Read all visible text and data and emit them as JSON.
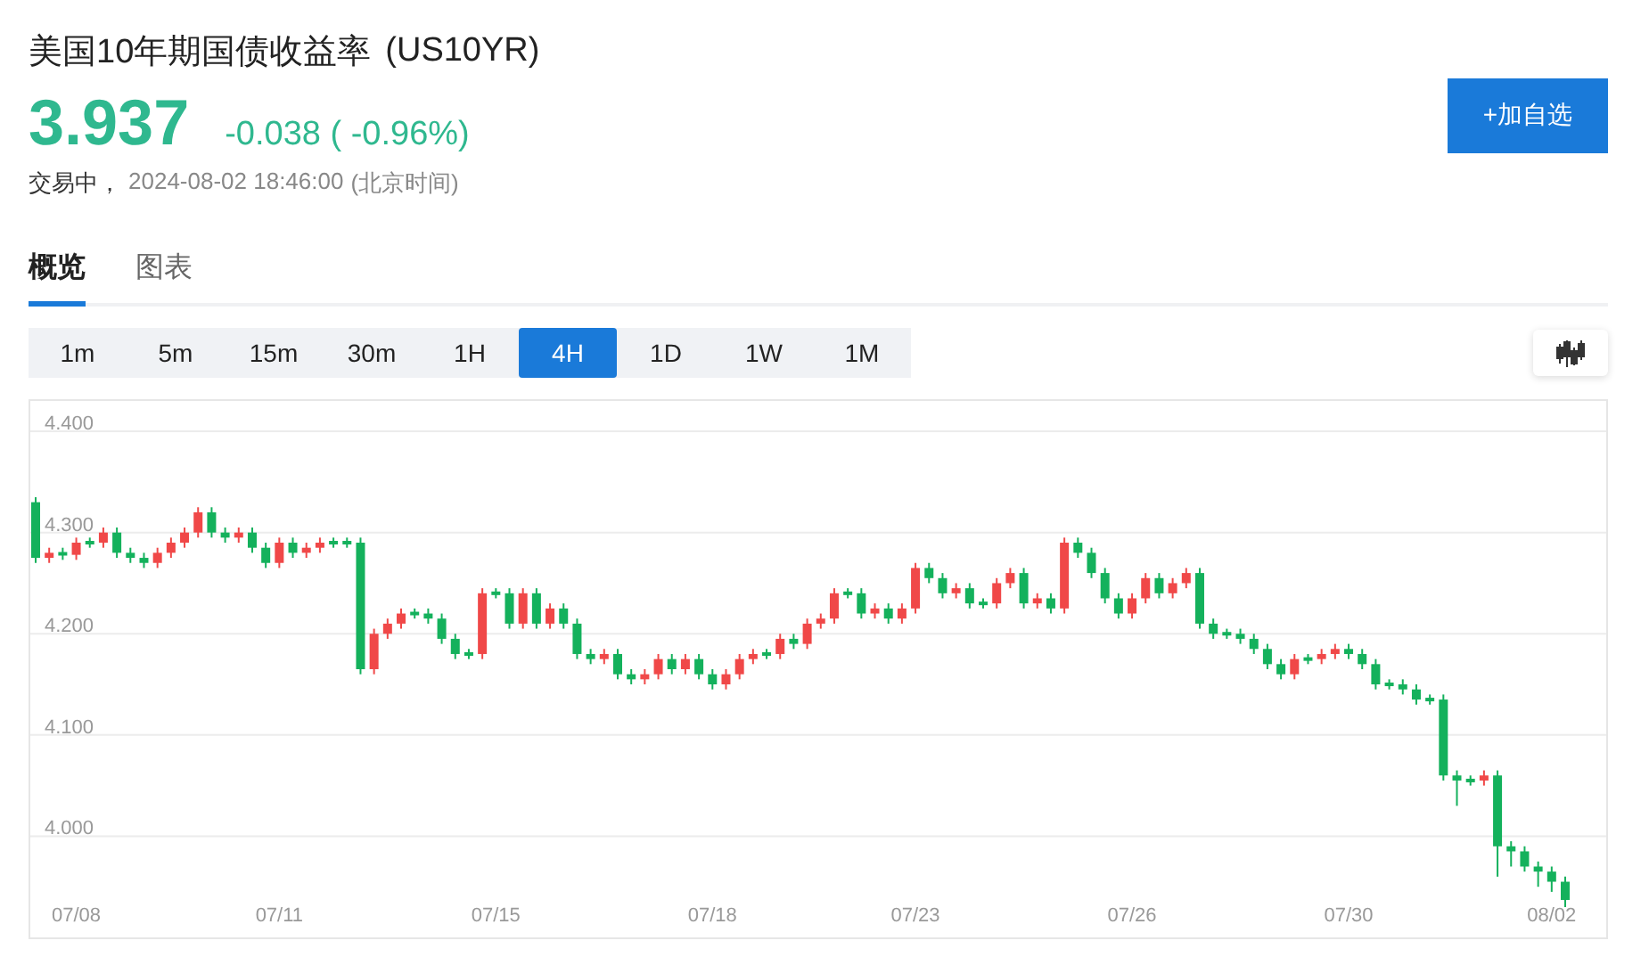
{
  "header": {
    "title": "美国10年期国债收益率",
    "symbol": "(US10YR)",
    "price": "3.937",
    "change": "-0.038 ( -0.96%)",
    "status": "交易中，",
    "timestamp": "2024-08-02 18:46:00",
    "timezone": "(北京时间)",
    "watch_button": "+加自选"
  },
  "tabs": [
    {
      "label": "概览",
      "selected": true
    },
    {
      "label": "图表",
      "selected": false
    }
  ],
  "intervals": [
    {
      "label": "1m",
      "selected": false
    },
    {
      "label": "5m",
      "selected": false
    },
    {
      "label": "15m",
      "selected": false
    },
    {
      "label": "30m",
      "selected": false
    },
    {
      "label": "1H",
      "selected": false
    },
    {
      "label": "4H",
      "selected": true
    },
    {
      "label": "1D",
      "selected": false
    },
    {
      "label": "1W",
      "selected": false
    },
    {
      "label": "1M",
      "selected": false
    }
  ],
  "chart": {
    "chart_data": {
      "type": "candlestick",
      "yticks": [
        {
          "value": 4.4,
          "label": "4.400"
        },
        {
          "value": 4.3,
          "label": "4.300"
        },
        {
          "value": 4.2,
          "label": "4.200"
        },
        {
          "value": 4.1,
          "label": "4.100"
        },
        {
          "value": 4.0,
          "label": "4.000"
        }
      ],
      "ylim": [
        3.9,
        4.43
      ],
      "grid": true,
      "categories": [
        null,
        null,
        null,
        "07/08",
        null,
        null,
        null,
        null,
        null,
        null,
        null,
        null,
        null,
        null,
        null,
        null,
        null,
        null,
        "07/11",
        null,
        null,
        null,
        null,
        null,
        null,
        null,
        null,
        null,
        null,
        null,
        null,
        null,
        null,
        null,
        "07/15",
        null,
        null,
        null,
        null,
        null,
        null,
        null,
        null,
        null,
        null,
        null,
        null,
        null,
        null,
        null,
        "07/18",
        null,
        null,
        null,
        null,
        null,
        null,
        null,
        null,
        null,
        null,
        null,
        null,
        null,
        null,
        "07/23",
        null,
        null,
        null,
        null,
        null,
        null,
        null,
        null,
        null,
        null,
        null,
        null,
        null,
        null,
        null,
        "07/26",
        null,
        null,
        null,
        null,
        null,
        null,
        null,
        null,
        null,
        null,
        null,
        null,
        null,
        null,
        null,
        "07/30",
        null,
        null,
        null,
        null,
        null,
        null,
        null,
        null,
        null,
        null,
        null,
        null,
        null,
        null,
        "08/02",
        null
      ],
      "ohlc": [
        [
          4.33,
          4.335,
          4.27,
          4.275
        ],
        [
          4.275,
          4.285,
          4.27,
          4.28
        ],
        [
          4.28,
          4.285,
          4.273,
          4.278
        ],
        [
          4.278,
          4.295,
          4.273,
          4.29
        ],
        [
          4.29,
          4.295,
          4.285,
          4.29
        ],
        [
          4.29,
          4.305,
          4.285,
          4.3
        ],
        [
          4.3,
          4.305,
          4.275,
          4.28
        ],
        [
          4.28,
          4.285,
          4.27,
          4.275
        ],
        [
          4.275,
          4.28,
          4.265,
          4.27
        ],
        [
          4.27,
          4.285,
          4.265,
          4.28
        ],
        [
          4.28,
          4.295,
          4.275,
          4.29
        ],
        [
          4.29,
          4.305,
          4.285,
          4.3
        ],
        [
          4.3,
          4.325,
          4.295,
          4.32
        ],
        [
          4.32,
          4.325,
          4.295,
          4.3
        ],
        [
          4.3,
          4.305,
          4.29,
          4.295
        ],
        [
          4.295,
          4.305,
          4.29,
          4.3
        ],
        [
          4.3,
          4.305,
          4.28,
          4.285
        ],
        [
          4.285,
          4.29,
          4.265,
          4.27
        ],
        [
          4.27,
          4.295,
          4.265,
          4.29
        ],
        [
          4.29,
          4.295,
          4.275,
          4.28
        ],
        [
          4.28,
          4.29,
          4.275,
          4.285
        ],
        [
          4.285,
          4.295,
          4.28,
          4.29
        ],
        [
          4.29,
          4.295,
          4.285,
          4.29
        ],
        [
          4.29,
          4.295,
          4.285,
          4.29
        ],
        [
          4.29,
          4.295,
          4.16,
          4.165
        ],
        [
          4.165,
          4.205,
          4.16,
          4.2
        ],
        [
          4.2,
          4.215,
          4.195,
          4.21
        ],
        [
          4.21,
          4.225,
          4.205,
          4.22
        ],
        [
          4.22,
          4.225,
          4.215,
          4.22
        ],
        [
          4.22,
          4.225,
          4.21,
          4.215
        ],
        [
          4.215,
          4.22,
          4.19,
          4.195
        ],
        [
          4.195,
          4.2,
          4.175,
          4.18
        ],
        [
          4.18,
          4.185,
          4.175,
          4.18
        ],
        [
          4.18,
          4.245,
          4.175,
          4.24
        ],
        [
          4.24,
          4.245,
          4.235,
          4.24
        ],
        [
          4.24,
          4.245,
          4.205,
          4.21
        ],
        [
          4.21,
          4.245,
          4.205,
          4.24
        ],
        [
          4.24,
          4.245,
          4.205,
          4.21
        ],
        [
          4.21,
          4.23,
          4.205,
          4.225
        ],
        [
          4.225,
          4.23,
          4.205,
          4.21
        ],
        [
          4.21,
          4.215,
          4.175,
          4.18
        ],
        [
          4.18,
          4.185,
          4.17,
          4.175
        ],
        [
          4.175,
          4.185,
          4.17,
          4.18
        ],
        [
          4.18,
          4.185,
          4.155,
          4.16
        ],
        [
          4.16,
          4.165,
          4.15,
          4.155
        ],
        [
          4.155,
          4.165,
          4.15,
          4.16
        ],
        [
          4.16,
          4.18,
          4.155,
          4.175
        ],
        [
          4.175,
          4.18,
          4.16,
          4.165
        ],
        [
          4.165,
          4.18,
          4.16,
          4.175
        ],
        [
          4.175,
          4.18,
          4.155,
          4.16
        ],
        [
          4.16,
          4.165,
          4.145,
          4.15
        ],
        [
          4.15,
          4.165,
          4.145,
          4.16
        ],
        [
          4.16,
          4.18,
          4.155,
          4.175
        ],
        [
          4.175,
          4.185,
          4.17,
          4.18
        ],
        [
          4.18,
          4.185,
          4.175,
          4.18
        ],
        [
          4.18,
          4.2,
          4.175,
          4.195
        ],
        [
          4.195,
          4.2,
          4.185,
          4.19
        ],
        [
          4.19,
          4.215,
          4.185,
          4.21
        ],
        [
          4.21,
          4.22,
          4.205,
          4.215
        ],
        [
          4.215,
          4.245,
          4.21,
          4.24
        ],
        [
          4.24,
          4.245,
          4.235,
          4.24
        ],
        [
          4.24,
          4.245,
          4.215,
          4.22
        ],
        [
          4.22,
          4.23,
          4.215,
          4.225
        ],
        [
          4.225,
          4.23,
          4.21,
          4.215
        ],
        [
          4.215,
          4.23,
          4.21,
          4.225
        ],
        [
          4.225,
          4.27,
          4.22,
          4.265
        ],
        [
          4.265,
          4.27,
          4.25,
          4.255
        ],
        [
          4.255,
          4.26,
          4.235,
          4.24
        ],
        [
          4.24,
          4.25,
          4.235,
          4.245
        ],
        [
          4.245,
          4.25,
          4.225,
          4.23
        ],
        [
          4.23,
          4.235,
          4.225,
          4.23
        ],
        [
          4.23,
          4.255,
          4.225,
          4.25
        ],
        [
          4.25,
          4.265,
          4.245,
          4.26
        ],
        [
          4.26,
          4.265,
          4.225,
          4.23
        ],
        [
          4.23,
          4.24,
          4.225,
          4.235
        ],
        [
          4.235,
          4.24,
          4.22,
          4.225
        ],
        [
          4.225,
          4.295,
          4.22,
          4.29
        ],
        [
          4.29,
          4.295,
          4.275,
          4.28
        ],
        [
          4.28,
          4.285,
          4.255,
          4.26
        ],
        [
          4.26,
          4.265,
          4.23,
          4.235
        ],
        [
          4.235,
          4.24,
          4.215,
          4.22
        ],
        [
          4.22,
          4.24,
          4.215,
          4.235
        ],
        [
          4.235,
          4.26,
          4.23,
          4.255
        ],
        [
          4.255,
          4.26,
          4.235,
          4.24
        ],
        [
          4.24,
          4.255,
          4.235,
          4.25
        ],
        [
          4.25,
          4.265,
          4.245,
          4.26
        ],
        [
          4.26,
          4.265,
          4.205,
          4.21
        ],
        [
          4.21,
          4.215,
          4.195,
          4.2
        ],
        [
          4.2,
          4.205,
          4.195,
          4.2
        ],
        [
          4.2,
          4.205,
          4.19,
          4.195
        ],
        [
          4.195,
          4.2,
          4.18,
          4.185
        ],
        [
          4.185,
          4.19,
          4.165,
          4.17
        ],
        [
          4.17,
          4.175,
          4.155,
          4.16
        ],
        [
          4.16,
          4.18,
          4.155,
          4.175
        ],
        [
          4.175,
          4.18,
          4.17,
          4.175
        ],
        [
          4.175,
          4.185,
          4.17,
          4.18
        ],
        [
          4.18,
          4.19,
          4.175,
          4.185
        ],
        [
          4.185,
          4.19,
          4.175,
          4.18
        ],
        [
          4.18,
          4.185,
          4.165,
          4.17
        ],
        [
          4.17,
          4.175,
          4.145,
          4.15
        ],
        [
          4.15,
          4.155,
          4.145,
          4.15
        ],
        [
          4.15,
          4.155,
          4.14,
          4.145
        ],
        [
          4.145,
          4.15,
          4.13,
          4.135
        ],
        [
          4.135,
          4.14,
          4.13,
          4.135
        ],
        [
          4.135,
          4.14,
          4.055,
          4.06
        ],
        [
          4.06,
          4.065,
          4.03,
          4.055
        ],
        [
          4.055,
          4.06,
          4.05,
          4.055
        ],
        [
          4.055,
          4.065,
          4.05,
          4.06
        ],
        [
          4.06,
          4.065,
          3.96,
          3.99
        ],
        [
          3.99,
          3.995,
          3.97,
          3.985
        ],
        [
          3.985,
          3.99,
          3.965,
          3.97
        ],
        [
          3.97,
          3.975,
          3.95,
          3.965
        ],
        [
          3.965,
          3.97,
          3.945,
          3.955
        ],
        [
          3.955,
          3.96,
          3.93,
          3.937
        ]
      ]
    }
  }
}
